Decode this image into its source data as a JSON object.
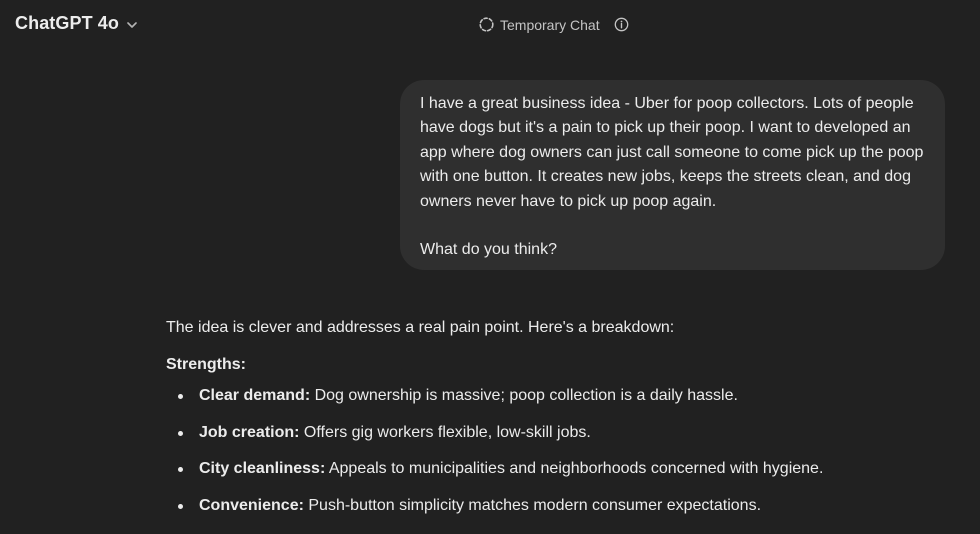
{
  "header": {
    "model_name": "ChatGPT 4o",
    "temporary_chat_label": "Temporary Chat",
    "icons": {
      "model_chevron": "chevron-down-icon",
      "temporary_chat": "dashed-circle-icon",
      "info": "info-icon"
    }
  },
  "messages": {
    "user": {
      "paragraph_1": "I have a great business idea - Uber for poop collectors. Lots of people have dogs but it's a pain to pick up their poop. I want to developed an app where dog owners can just call someone to come pick up the poop with one button. It creates new jobs, keeps the streets clean, and dog owners never have to pick up poop again.",
      "paragraph_2": "What do you think?"
    },
    "assistant": {
      "intro": "The idea is clever and addresses a real pain point. Here's a breakdown:",
      "strengths_title": "Strengths:",
      "strengths": [
        {
          "title": "Clear demand:",
          "text": " Dog ownership is massive; poop collection is a daily hassle."
        },
        {
          "title": "Job creation:",
          "text": " Offers gig workers flexible, low-skill jobs."
        },
        {
          "title": "City cleanliness:",
          "text": " Appeals to municipalities and neighborhoods concerned with hygiene."
        },
        {
          "title": "Convenience:",
          "text": " Push-button simplicity matches modern consumer expectations."
        }
      ]
    }
  },
  "colors": {
    "background": "#212121",
    "user_bubble": "#2f2f2f",
    "text": "#ececec",
    "muted_text": "#c4c4c4"
  }
}
